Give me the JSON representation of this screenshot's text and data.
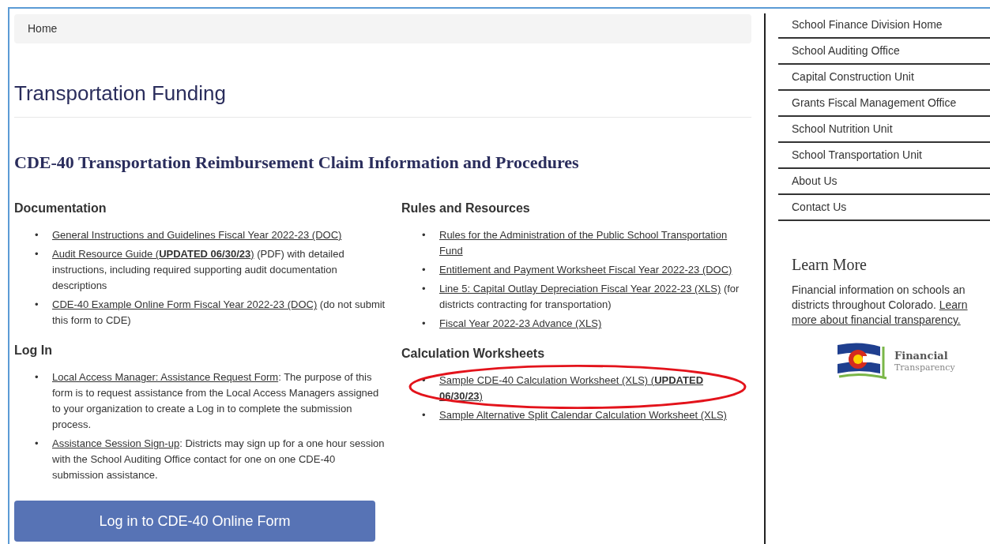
{
  "breadcrumb": [
    "Home"
  ],
  "page_title": "Transportation Funding",
  "section_title": "CDE-40 Transportation Reimbursement Claim Information and Procedures",
  "left_groups": [
    {
      "heading": "Documentation",
      "items": [
        {
          "bullet": "•",
          "link": "General Instructions and Guidelines Fiscal Year 2022-23 (DOC)"
        },
        {
          "bullet": "•",
          "link": "Audit Resource Guide (**UPDATED 06/30/23**)",
          "text": " (PDF) with detailed instructions, including required supporting audit documentation descriptions"
        },
        {
          "bullet": "•",
          "link": "CDE-40 Example Online Form Fiscal Year 2022-23 (DOC)",
          "text": " (do not submit this form to CDE)"
        }
      ]
    },
    {
      "heading": "Log In",
      "items": [
        {
          "bullet": "•",
          "link": "Local Access Manager: Assistance Request Form",
          "text": ": The purpose of this form is to request assistance from the Local Access Managers assigned to your organization to create a Log in to complete the submission process."
        },
        {
          "bullet": "•",
          "link": "Assistance Session Sign-up",
          "text": ":  Districts may sign up for a one hour session with the School Auditing Office contact for one on one CDE-40 submission assistance."
        }
      ]
    }
  ],
  "right_groups": [
    {
      "heading": "Rules and Resources",
      "items": [
        {
          "bullet": "•",
          "link": "Rules for the Administration of the Public School Transportation Fund"
        },
        {
          "bullet": "•",
          "link": "Entitlement and Payment Worksheet Fiscal Year 2022-23 (DOC)"
        },
        {
          "bullet": "•",
          "link": "Line 5: Capital Outlay Depreciation Fiscal Year 2022-23 (XLS)",
          "text": " (for districts contracting for transportation)"
        },
        {
          "bullet": "•",
          "link": "Fiscal Year 2022-23 Advance (XLS)"
        }
      ]
    },
    {
      "heading": "Calculation Worksheets",
      "items": [
        {
          "bullet": "•",
          "link": "Sample CDE-40 Calculation Worksheet (XLS) (**UPDATED 06/30/23**)",
          "highlighted": true
        },
        {
          "bullet": "•",
          "link": "Sample Alternative Split Calendar Calculation Worksheet (XLS)",
          "highlighted": false
        }
      ]
    }
  ],
  "login_button": "Log in to CDE-40 Online Form",
  "sidebar": {
    "items": [
      "School Finance Division Home",
      "School Auditing Office",
      "Capital Construction Unit",
      "Grants Fiscal Management Office",
      "School Nutrition Unit",
      "School Transportation Unit",
      "About Us",
      "Contact Us"
    ]
  },
  "learn_more": {
    "title": "Learn More",
    "lines": [
      {
        "text": "Financial information on schools an"
      },
      {
        "text": "districts throughout Colorado. ",
        "link": "Learn"
      },
      {
        "link": "more about financial transparency."
      }
    ],
    "logo": {
      "title": "Financial",
      "subtitle": "Transparency"
    }
  }
}
